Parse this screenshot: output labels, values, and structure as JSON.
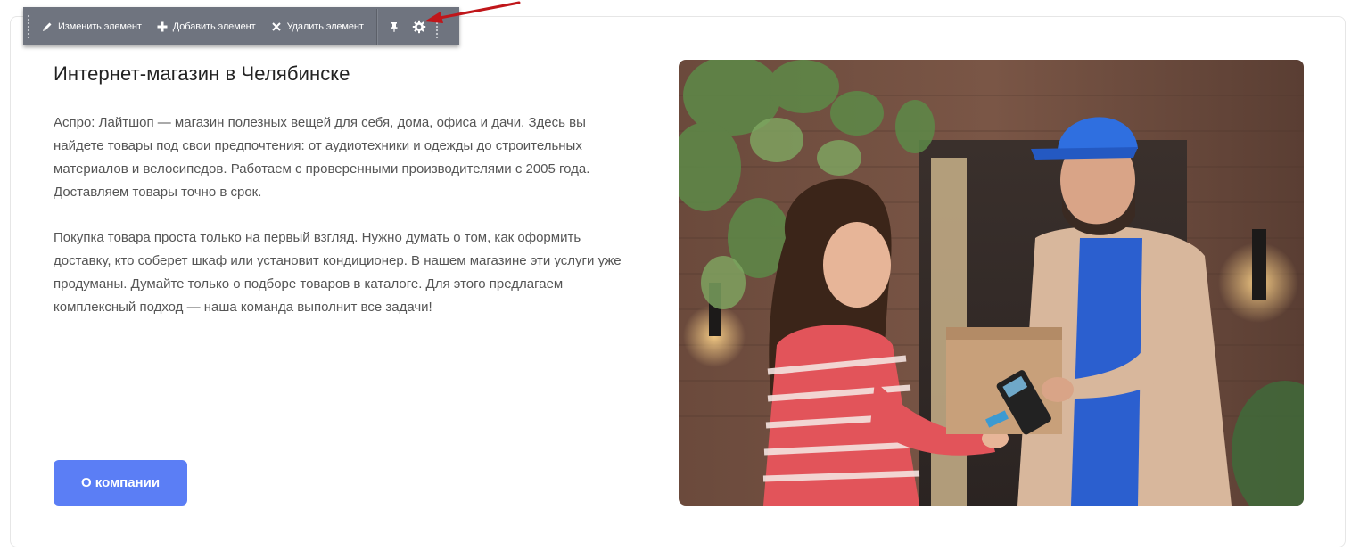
{
  "toolbar": {
    "edit_label": "Изменить элемент",
    "add_label": "Добавить элемент",
    "delete_label": "Удалить элемент",
    "bg_color": "#6f747f"
  },
  "content": {
    "title": "Интернет-магазин в Челябинске",
    "paragraph_1": "Аспро: Лайтшоп — магазин полезных вещей для себя, дома, офиса и дачи. Здесь вы найдете товары под свои предпочтения: от аудиотехники и одежды до строительных материалов и велосипедов. Работаем с проверенными производителями с 2005 года. Доставляем товары точно в срок.",
    "paragraph_2": "Покупка товара проста только на первый взгляд. Нужно думать о том, как оформить доставку, кто соберет шкаф или установит кондиционер. В нашем магазине эти услуги уже продуманы. Думайте только о подборе товаров в каталоге. Для этого предлагаем комплексный подход — наша команда выполнит все задачи!",
    "button_label": "О компании",
    "accent_color": "#5b7ef5"
  },
  "icons": {
    "edit": "pencil-icon",
    "add": "plus-icon",
    "delete": "close-icon",
    "pin": "pin-icon",
    "settings": "gear-icon",
    "annotation": "red-arrow"
  }
}
